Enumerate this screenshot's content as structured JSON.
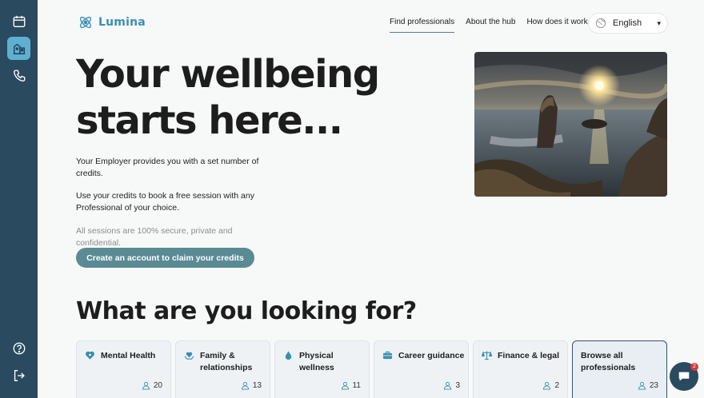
{
  "brand": {
    "name": "Lumina",
    "accent": "#3a8fb0",
    "sidebar_bg": "#2a4a5f"
  },
  "sidebar": {
    "items": [
      {
        "name": "calendar-icon",
        "active": false
      },
      {
        "name": "hub-icon",
        "active": true
      },
      {
        "name": "phone-icon",
        "active": false
      }
    ],
    "bottom": [
      {
        "name": "help-icon"
      },
      {
        "name": "logout-icon"
      }
    ]
  },
  "nav": {
    "items": [
      {
        "label": "Find professionals",
        "active": true
      },
      {
        "label": "About the hub",
        "active": false
      },
      {
        "label": "How does it work",
        "active": false
      }
    ],
    "language": "English"
  },
  "hero": {
    "title_line1": "Your wellbeing",
    "title_line2": "starts here...",
    "para1": "Your Employer provides you with a set number of credits.",
    "para2": "Use your credits to book a free session with any Professional of your choice.",
    "para3": "All sessions are 100% secure, private and confidential.",
    "cta": "Create an account to claim your credits",
    "image": "coastal-sunset-sea-stack"
  },
  "looking_for": {
    "title": "What are you looking for?",
    "cards": [
      {
        "label": "Mental Health",
        "count": "20",
        "icon": "heart-brain-icon"
      },
      {
        "label": "Family & relationships",
        "count": "13",
        "icon": "heart-hands-icon"
      },
      {
        "label": "Physical wellness",
        "count": "11",
        "icon": "drop-icon"
      },
      {
        "label": "Career guidance",
        "count": "3",
        "icon": "briefcase-icon"
      },
      {
        "label": "Finance & legal",
        "count": "2",
        "icon": "scales-icon"
      },
      {
        "label": "Browse all professionals",
        "count": "23",
        "icon": ""
      }
    ]
  },
  "chat": {
    "badge": "2"
  }
}
